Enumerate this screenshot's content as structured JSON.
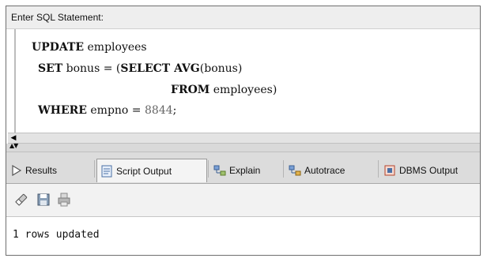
{
  "editor": {
    "header": "Enter SQL Statement:",
    "lines": [
      {
        "kw": "UPDATE",
        "text": " employees"
      },
      {
        "kw": "SET",
        "text": " bonus = (",
        "kw2": "SELECT AVG",
        "text2": "(bonus)"
      },
      {
        "kw": "FROM",
        "text": " employees)"
      },
      {
        "kw": "WHERE",
        "text": " empno = ",
        "num": "8844",
        "text2": ";"
      }
    ]
  },
  "tabs": [
    {
      "label": "Results",
      "icon": "play-triangle-icon",
      "active": false
    },
    {
      "label": "Script Output",
      "icon": "script-output-icon",
      "active": true
    },
    {
      "label": "Explain",
      "icon": "explain-plan-icon",
      "active": false
    },
    {
      "label": "Autotrace",
      "icon": "autotrace-icon",
      "active": false
    },
    {
      "label": "DBMS Output",
      "icon": "dbms-output-icon",
      "active": false
    }
  ],
  "toolbar": {
    "icons": [
      "eraser-icon",
      "save-icon",
      "print-icon"
    ]
  },
  "output": {
    "text": "1 rows updated"
  }
}
